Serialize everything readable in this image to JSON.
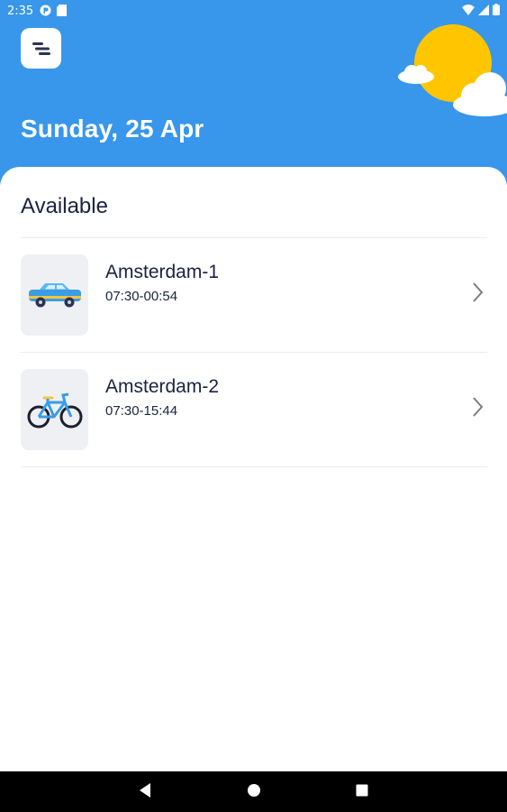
{
  "status_bar": {
    "time": "2:35",
    "left_icons": [
      "notification-app-icon",
      "sd-card-icon"
    ],
    "right_icons": [
      "wifi-icon",
      "signal-icon",
      "battery-icon"
    ]
  },
  "header": {
    "date": "Sunday, 25 Apr",
    "weather_icon": "sun-behind-clouds-icon",
    "colors": {
      "background": "#3897ea",
      "sun": "#ffc600"
    }
  },
  "main": {
    "section_title": "Available",
    "items": [
      {
        "name": "Amsterdam-1",
        "hours": "07:30-00:54",
        "vehicle": "car-icon"
      },
      {
        "name": "Amsterdam-2",
        "hours": "07:30-15:44",
        "vehicle": "bicycle-icon"
      }
    ]
  },
  "nav_bar": {
    "buttons": [
      "back-icon",
      "home-icon",
      "recents-icon"
    ]
  }
}
